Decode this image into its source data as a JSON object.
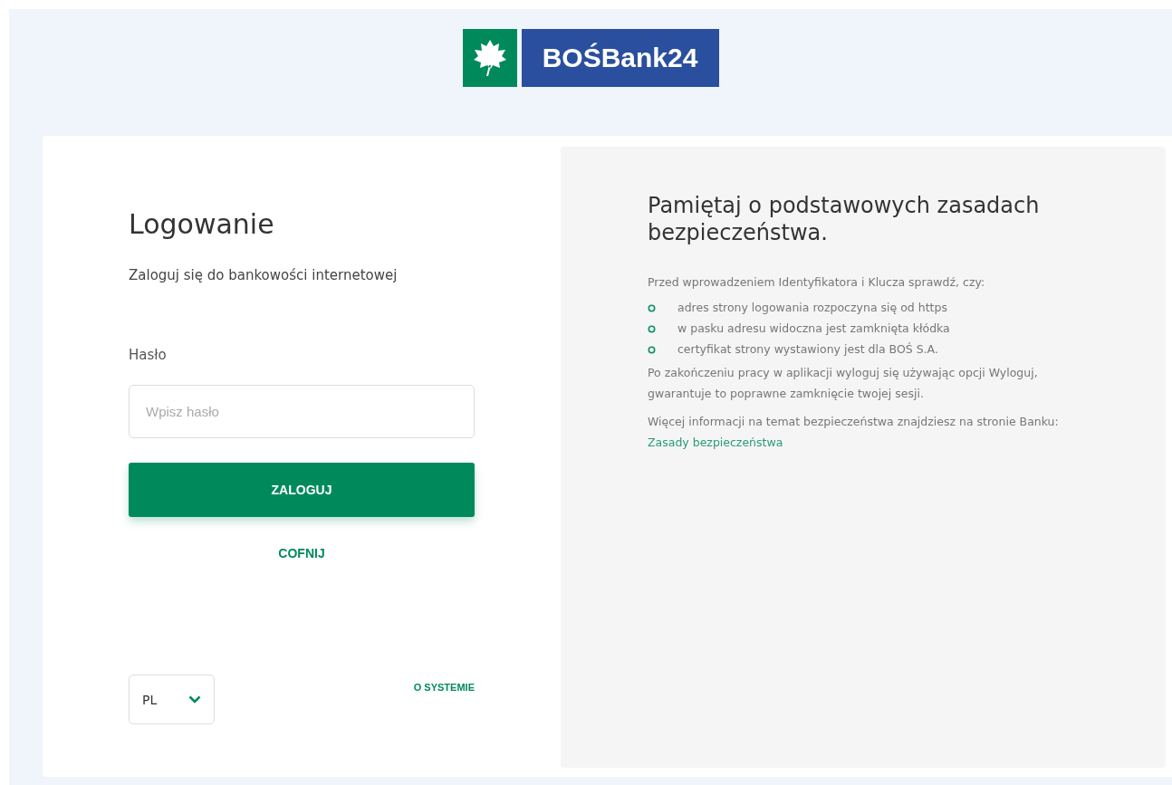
{
  "logo": {
    "text": "BOŚBank24"
  },
  "login": {
    "title": "Logowanie",
    "subtitle": "Zaloguj się do bankowości internetowej",
    "password_label": "Hasło",
    "password_placeholder": "Wpisz hasło",
    "submit": "ZALOGUJ",
    "back": "COFNIJ",
    "language": "PL",
    "about": "O SYSTEMIE"
  },
  "security": {
    "title": "Pamiętaj o podstawowych zasadach bezpieczeństwa.",
    "intro": "Przed wprowadzeniem Identyfikatora i Klucza sprawdź, czy:",
    "checks": [
      "adres strony logowania rozpoczyna się od https",
      "w pasku adresu widoczna jest zamknięta kłódka",
      "certyfikat strony wystawiony jest dla BOŚ S.A."
    ],
    "logout_note": "Po zakończeniu pracy w aplikacji wyloguj się używając opcji Wyloguj, gwarantuje to poprawne zamknięcie twojej sesji.",
    "more_info": "Więcej informacji na temat bezpieczeństwa znajdziesz na stronie Banku: ",
    "link": "Zasady bezpieczeństwa"
  }
}
